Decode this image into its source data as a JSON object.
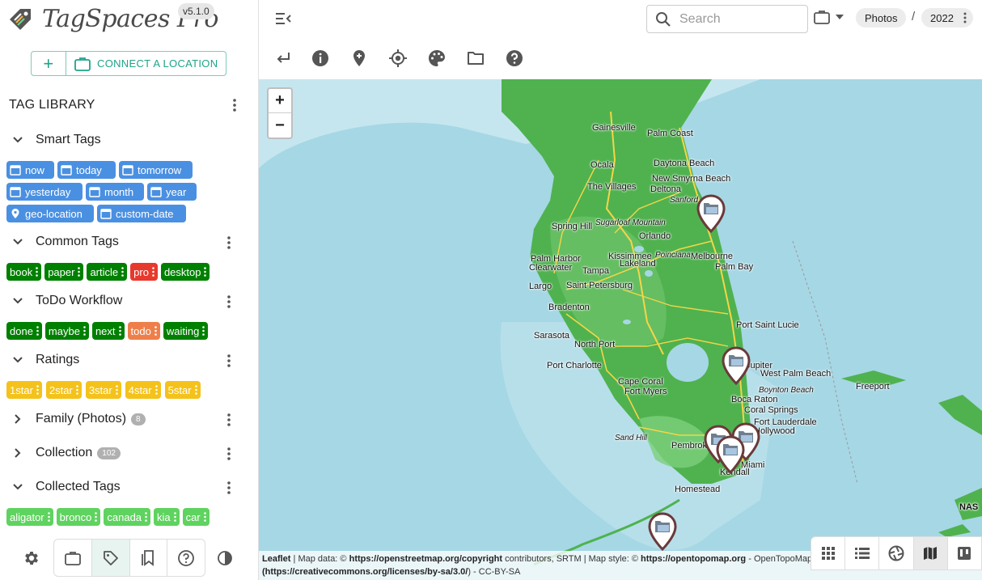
{
  "app": {
    "name": "TagSpaces Pro",
    "version": "v5.1.0"
  },
  "location_buttons": {
    "add": "+",
    "connect": "CONNECT A LOCATION"
  },
  "tag_library": {
    "title": "TAG LIBRARY",
    "groups": [
      {
        "name": "Smart Tags",
        "expanded": true,
        "color": "#4a90e2",
        "tags": [
          "now",
          "today",
          "tomorrow",
          "yesterday",
          "month",
          "year",
          "geo-location",
          "custom-date"
        ]
      },
      {
        "name": "Common Tags",
        "expanded": true,
        "tags": [
          {
            "label": "book",
            "color": "#008000"
          },
          {
            "label": "paper",
            "color": "#008000"
          },
          {
            "label": "article",
            "color": "#008000"
          },
          {
            "label": "pro",
            "color": "#e8392d"
          },
          {
            "label": "desktop",
            "color": "#008000"
          }
        ]
      },
      {
        "name": "ToDo Workflow",
        "expanded": true,
        "tags": [
          {
            "label": "done",
            "color": "#008000"
          },
          {
            "label": "maybe",
            "color": "#008000"
          },
          {
            "label": "next",
            "color": "#008000"
          },
          {
            "label": "todo",
            "color": "#ef7f4a"
          },
          {
            "label": "waiting",
            "color": "#008000"
          }
        ]
      },
      {
        "name": "Ratings",
        "expanded": true,
        "color": "#f4c21a",
        "tags": [
          "1star",
          "2star",
          "3star",
          "4star",
          "5star"
        ]
      },
      {
        "name": "Family (Photos)",
        "expanded": false,
        "count": "8"
      },
      {
        "name": "Collection",
        "expanded": false,
        "count": "102"
      },
      {
        "name": "Collected Tags",
        "expanded": true,
        "color": "#5fd35f",
        "tags": [
          "aligator",
          "bronco",
          "canada",
          "kia",
          "car"
        ]
      }
    ]
  },
  "bottom_nav": {
    "icons": [
      "settings-icon",
      "locations-icon",
      "tag-library-icon",
      "bookmarks-icon",
      "help-icon",
      "theme-toggle-icon"
    ],
    "active": "tag-library-icon"
  },
  "header": {
    "search_placeholder": "Search",
    "breadcrumbs": [
      "Photos",
      "2022"
    ],
    "separator": "/"
  },
  "toolbar": {
    "icons": [
      "back-icon",
      "info-icon",
      "add-location-pin-icon",
      "my-location-icon",
      "palette-icon",
      "folder-icon",
      "help-icon"
    ]
  },
  "map": {
    "zoom_in": "+",
    "zoom_out": "−",
    "places": [
      "Gainesville",
      "Palm Coast",
      "Ocala",
      "Daytona Beach",
      "New Smyrna Beach",
      "The Villages",
      "Deltona",
      "Sanford",
      "Spring Hill",
      "Sugarloaf Mountain",
      "Orlando",
      "Palm Harbor",
      "Kissimmee",
      "Poinciana",
      "Melbourne",
      "Clearwater",
      "Lakeland",
      "Palm Bay",
      "Tampa",
      "Largo",
      "Saint Petersburg",
      "Bradenton",
      "Port Saint Lucie",
      "Sarasota",
      "North Port",
      "Port Charlotte",
      "Jupiter",
      "West Palm Beach",
      "Freeport",
      "Cape Coral",
      "Fort Myers",
      "Boynton Beach",
      "Boca Raton",
      "Coral Springs",
      "Fort Lauderdale",
      "Hollywood",
      "Sand Hill",
      "Pembroke Pines",
      "Miami",
      "Kendall",
      "Homestead",
      "NAS"
    ],
    "attribution": {
      "leaflet": "Leaflet",
      "map_data": "| Map data: ©",
      "osm_url": "https://openstreetmap.org/copyright",
      "contributors": "contributors, SRTM | Map style: ©",
      "style_url": "https://opentopomap.org",
      "tail": "- OpenTopoMap",
      "license_url": "(https://creativecommons.org/licenses/by-sa/3.0/",
      "license_tail": ") - CC-BY-SA"
    }
  },
  "view_switcher": {
    "icons": [
      "grid-view-icon",
      "list-view-icon",
      "gallery-view-icon",
      "map-view-icon",
      "kanban-view-icon"
    ],
    "active": "map-view-icon"
  }
}
